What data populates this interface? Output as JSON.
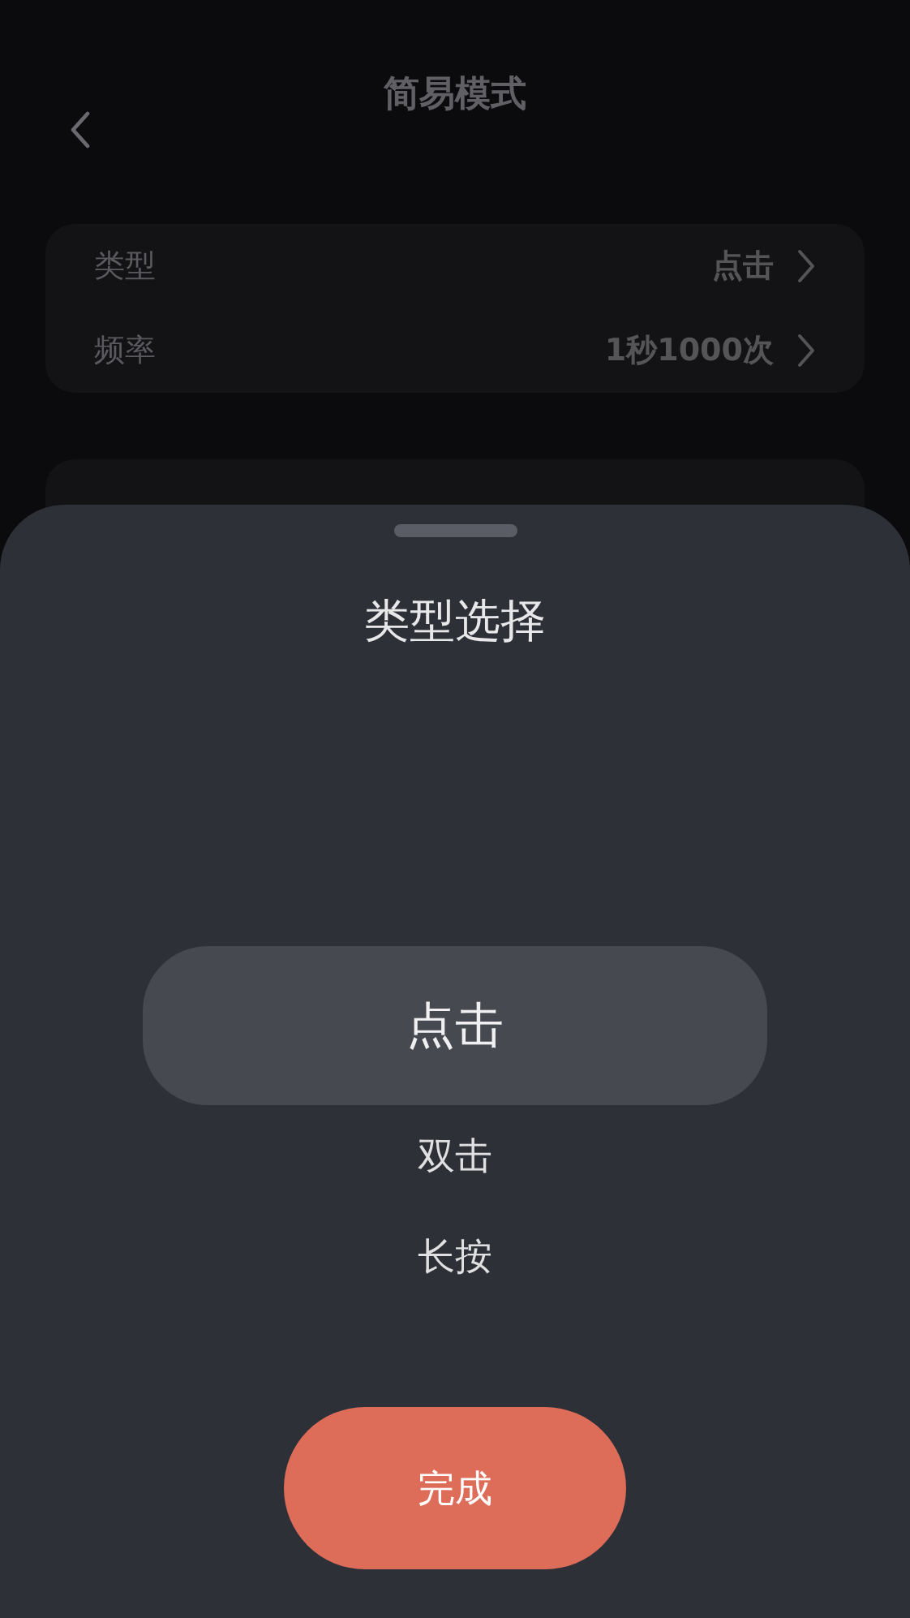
{
  "header": {
    "title": "简易模式"
  },
  "settings": [
    {
      "label": "类型",
      "value": "点击"
    },
    {
      "label": "频率",
      "value": "1秒1000次"
    }
  ],
  "sheet": {
    "title": "类型选择",
    "options": [
      {
        "label": "点击",
        "selected": true
      },
      {
        "label": "双击",
        "selected": false
      },
      {
        "label": "长按",
        "selected": false
      }
    ],
    "confirm": "完成"
  }
}
